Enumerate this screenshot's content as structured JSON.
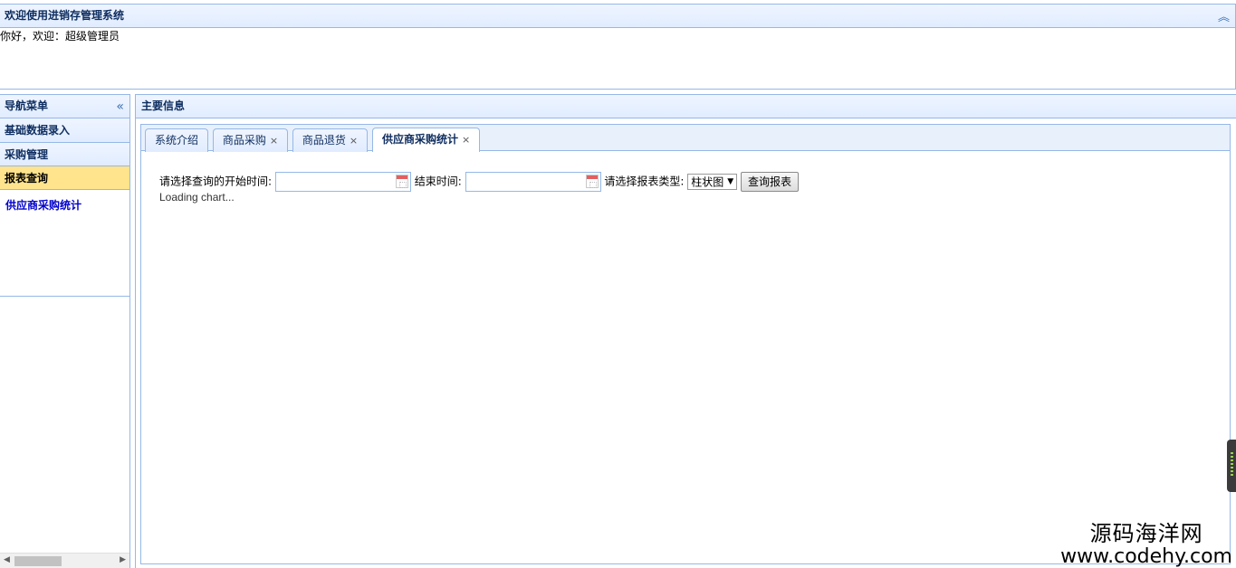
{
  "header": {
    "title": "欢迎使用进销存管理系统",
    "greeting": "你好，欢迎：超级管理员"
  },
  "nav": {
    "title": "导航菜单",
    "sections": [
      {
        "label": "基础数据录入"
      },
      {
        "label": "采购管理"
      },
      {
        "label": "报表查询"
      }
    ],
    "active_links": [
      "供应商采购统计"
    ]
  },
  "main": {
    "title": "主要信息",
    "tabs": [
      {
        "label": "系统介绍"
      },
      {
        "label": "商品采购"
      },
      {
        "label": "商品退货"
      },
      {
        "label": "供应商采购统计"
      }
    ],
    "form": {
      "start_label": "请选择查询的开始时间:",
      "start_value": "",
      "end_label": "结束时间:",
      "end_value": "",
      "type_label": "请选择报表类型:",
      "type_selected": "柱状图",
      "query_button": "查询报表"
    },
    "loading_text": "Loading chart..."
  },
  "watermark": {
    "line1": "源码海洋网",
    "line2": "www.codehy.com"
  }
}
